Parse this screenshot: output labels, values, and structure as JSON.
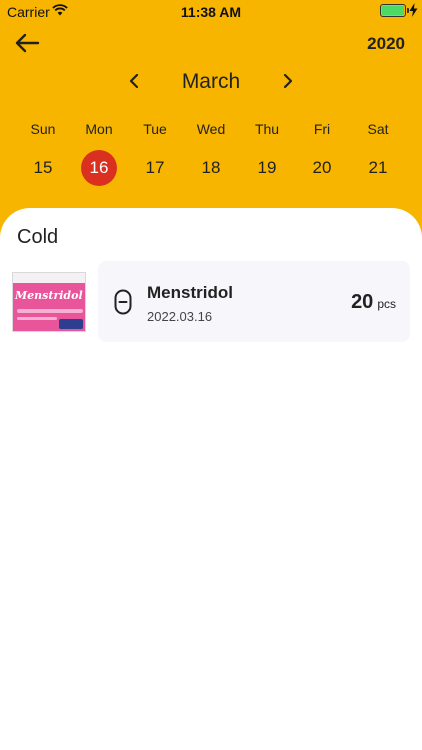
{
  "status_bar": {
    "carrier": "Carrier",
    "time": "11:38 AM",
    "battery_color": "#4CD964"
  },
  "header": {
    "background": "#F7B500",
    "back_icon": "arrow-left-icon",
    "year": "2020",
    "month": "March",
    "prev_icon": "chevron-left-icon",
    "next_icon": "chevron-right-icon"
  },
  "calendar": {
    "weekdays": [
      "Sun",
      "Mon",
      "Tue",
      "Wed",
      "Thu",
      "Fri",
      "Sat"
    ],
    "days": [
      "15",
      "16",
      "17",
      "18",
      "19",
      "20",
      "21"
    ],
    "selected_day": "16",
    "selected_color": "#D9301F"
  },
  "content": {
    "category": "Cold",
    "medicines": [
      {
        "image_brand": "Menstridol",
        "icon": "pill-icon",
        "name": "Menstridol",
        "date": "2022.03.16",
        "quantity": "20",
        "unit": "pcs"
      }
    ]
  }
}
